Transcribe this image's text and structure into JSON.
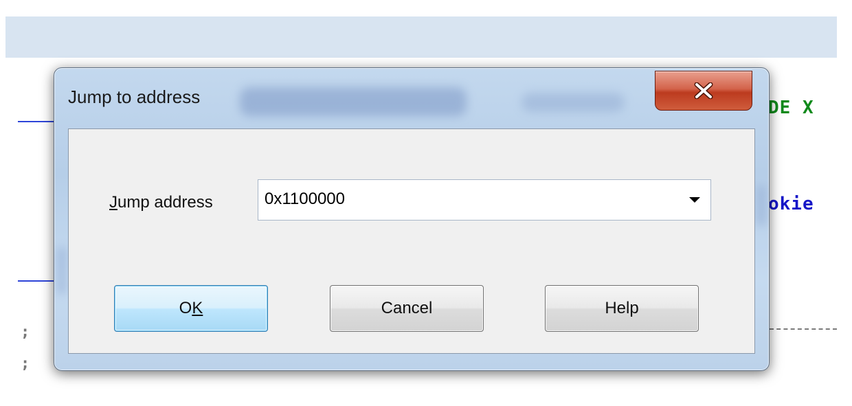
{
  "background": {
    "code_fragment_green": "DE X",
    "code_fragment_blue": "okie",
    "semicolon_1": ";",
    "semicolon_2": ";"
  },
  "dialog": {
    "title": "Jump to address",
    "close_icon": "close-x-icon",
    "field": {
      "label_mnemonic": "J",
      "label_rest": "ump address",
      "value": "0x1100000",
      "dropdown_icon": "chevron-down-icon"
    },
    "buttons": {
      "ok_prefix": "O",
      "ok_mnemonic": "K",
      "cancel": "Cancel",
      "help": "Help"
    }
  },
  "colors": {
    "code_green": "#118a1c",
    "code_blue": "#1616c8",
    "close_button": "#c7452a",
    "default_button_border": "#3c7fb1"
  }
}
